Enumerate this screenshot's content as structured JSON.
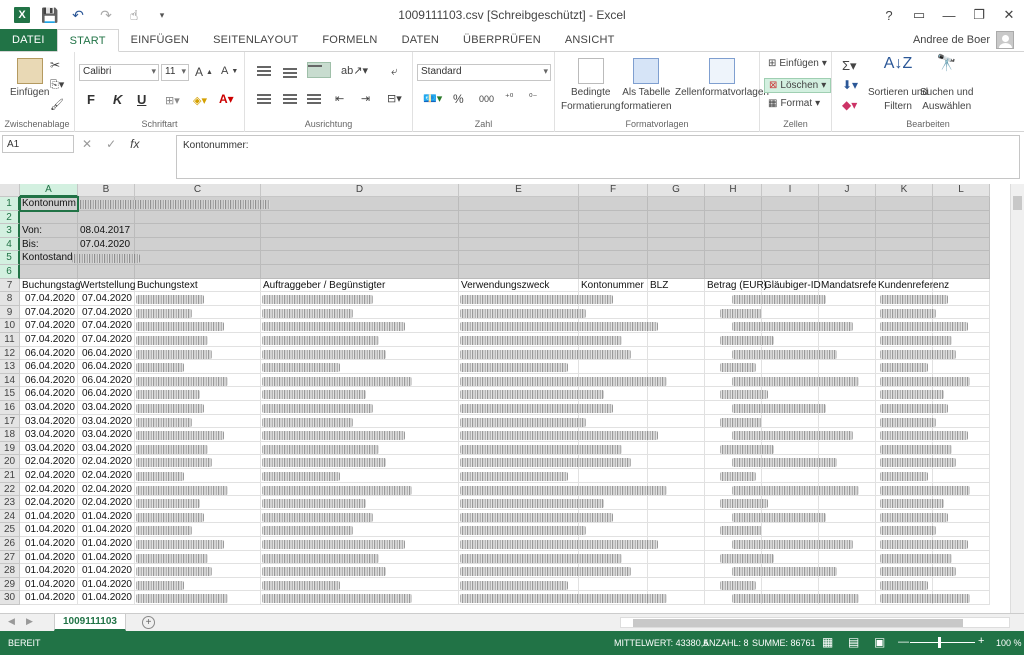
{
  "window": {
    "title": "1009111103.csv  [Schreibgeschützt] - Excel"
  },
  "qat": {
    "save_icon": "save-icon",
    "undo_icon": "undo-icon",
    "redo_icon": "redo-icon",
    "touch_icon": "touch-mode-icon"
  },
  "window_controls": {
    "help": "?",
    "restore_ribbon": "▭",
    "minimize": "—",
    "maximize": "❐",
    "close": "✕"
  },
  "tabs": [
    {
      "label": "DATEI"
    },
    {
      "label": "START"
    },
    {
      "label": "EINFÜGEN"
    },
    {
      "label": "SEITENLAYOUT"
    },
    {
      "label": "FORMELN"
    },
    {
      "label": "DATEN"
    },
    {
      "label": "ÜBERPRÜFEN"
    },
    {
      "label": "ANSICHT"
    }
  ],
  "user": {
    "name": "Andree de Boer"
  },
  "ribbon": {
    "clipboard": {
      "label": "Zwischenablage",
      "paste": "Einfügen"
    },
    "font": {
      "label": "Schriftart",
      "name": "Calibri",
      "size": "11",
      "bold": "F",
      "italic": "K",
      "underline": "U"
    },
    "alignment": {
      "label": "Ausrichtung"
    },
    "number": {
      "label": "Zahl",
      "format": "Standard",
      "percent": "%",
      "thousands": "000"
    },
    "styles": {
      "label": "Formatvorlagen",
      "conditional": "Bedingte\nFormatierung",
      "conditional_1": "Bedingte",
      "conditional_2": "Formatierung",
      "as_table_1": "Als Tabelle",
      "as_table_2": "formatieren",
      "cell_styles": "Zellenformatvorlagen"
    },
    "cells": {
      "label": "Zellen",
      "insert": "Einfügen",
      "delete": "Löschen",
      "format": "Format"
    },
    "editing": {
      "label": "Bearbeiten",
      "sort_1": "Sortieren und",
      "sort_2": "Filtern",
      "find_1": "Suchen und",
      "find_2": "Auswählen"
    }
  },
  "formula_bar": {
    "name_box": "A1",
    "cancel": "✕",
    "enter": "✓",
    "fx": "fx",
    "content": "Kontonummer:"
  },
  "columns": [
    "A",
    "B",
    "C",
    "D",
    "E",
    "F",
    "G",
    "H",
    "I",
    "J",
    "K",
    "L"
  ],
  "rows": [
    "1",
    "2",
    "3",
    "4",
    "5",
    "6",
    "7",
    "8",
    "9",
    "10",
    "11",
    "12",
    "13",
    "14",
    "15",
    "16",
    "17",
    "18",
    "19",
    "20",
    "21",
    "22",
    "23",
    "24",
    "25",
    "26",
    "27",
    "28",
    "29",
    "30"
  ],
  "sheet": {
    "a1": "Kontonumm",
    "a3": "Von:",
    "b3": "08.04.2017",
    "a4": "Bis:",
    "b4": "07.04.2020",
    "a5": "Kontostand",
    "headers": [
      "Buchungstag",
      "Wertstellung",
      "Buchungstext",
      "Auftraggeber / Begünstigter",
      "Verwendungszweck",
      "Kontonummer",
      "BLZ",
      "Betrag (EUR)",
      "Gläubiger-ID",
      "Mandatsrefe",
      "Kundenreferenz"
    ],
    "dates": [
      "07.04.2020",
      "07.04.2020",
      "07.04.2020",
      "07.04.2020",
      "06.04.2020",
      "06.04.2020",
      "06.04.2020",
      "06.04.2020",
      "03.04.2020",
      "03.04.2020",
      "03.04.2020",
      "03.04.2020",
      "02.04.2020",
      "02.04.2020",
      "02.04.2020",
      "02.04.2020",
      "01.04.2020",
      "01.04.2020",
      "01.04.2020",
      "01.04.2020",
      "01.04.2020",
      "01.04.2020",
      "01.04.2020"
    ]
  },
  "sheet_tabs": [
    {
      "label": "1009111103"
    }
  ],
  "status": {
    "ready": "BEREIT",
    "average": "MITTELWERT: 43380,5",
    "count": "ANZAHL: 8",
    "sum": "SUMME: 86761",
    "zoom": "100 %"
  }
}
